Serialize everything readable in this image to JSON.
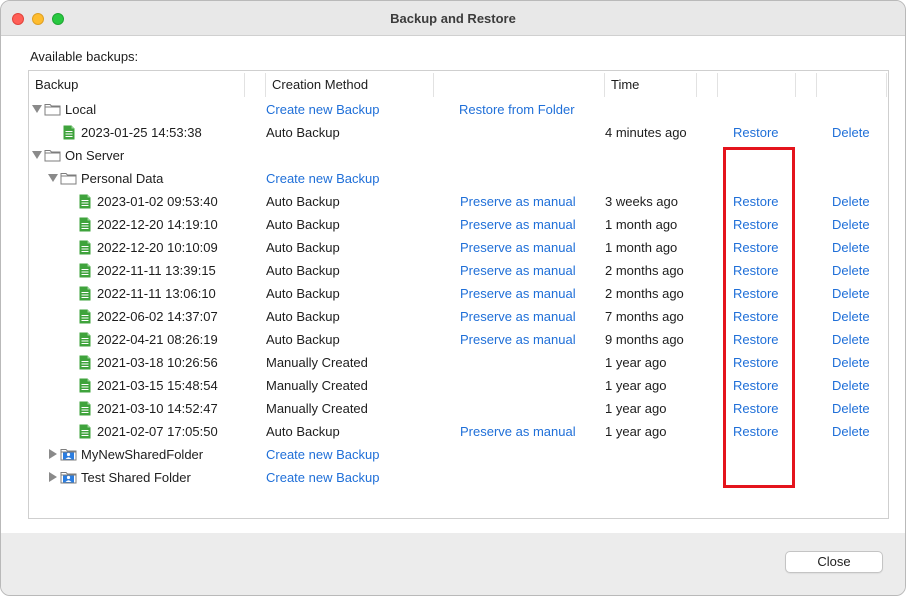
{
  "window": {
    "title": "Backup and Restore"
  },
  "label": "Available backups:",
  "columns": {
    "backup": "Backup",
    "creation_method": "Creation Method",
    "time": "Time"
  },
  "groups": {
    "local": {
      "name": "Local",
      "create": "Create new Backup",
      "restore_from_folder": "Restore from Folder",
      "items": [
        {
          "name": "2023-01-25 14:53:38",
          "method": "Auto Backup",
          "preserve": "",
          "time": "4 minutes ago",
          "restore": "Restore",
          "delete": "Delete"
        }
      ]
    },
    "server": {
      "name": "On Server",
      "personal": {
        "name": "Personal Data",
        "create": "Create new Backup",
        "items": [
          {
            "name": "2023-01-02 09:53:40",
            "method": "Auto Backup",
            "preserve": "Preserve as manual",
            "time": "3 weeks ago",
            "restore": "Restore",
            "delete": "Delete"
          },
          {
            "name": "2022-12-20 14:19:10",
            "method": "Auto Backup",
            "preserve": "Preserve as manual",
            "time": "1 month ago",
            "restore": "Restore",
            "delete": "Delete"
          },
          {
            "name": "2022-12-20 10:10:09",
            "method": "Auto Backup",
            "preserve": "Preserve as manual",
            "time": "1 month ago",
            "restore": "Restore",
            "delete": "Delete"
          },
          {
            "name": "2022-11-11 13:39:15",
            "method": "Auto Backup",
            "preserve": "Preserve as manual",
            "time": "2 months ago",
            "restore": "Restore",
            "delete": "Delete"
          },
          {
            "name": "2022-11-11 13:06:10",
            "method": "Auto Backup",
            "preserve": "Preserve as manual",
            "time": "2 months ago",
            "restore": "Restore",
            "delete": "Delete"
          },
          {
            "name": "2022-06-02 14:37:07",
            "method": "Auto Backup",
            "preserve": "Preserve as manual",
            "time": "7 months ago",
            "restore": "Restore",
            "delete": "Delete"
          },
          {
            "name": "2022-04-21 08:26:19",
            "method": "Auto Backup",
            "preserve": "Preserve as manual",
            "time": "9 months ago",
            "restore": "Restore",
            "delete": "Delete"
          },
          {
            "name": "2021-03-18 10:26:56",
            "method": "Manually Created",
            "preserve": "",
            "time": "1 year ago",
            "restore": "Restore",
            "delete": "Delete"
          },
          {
            "name": "2021-03-15 15:48:54",
            "method": "Manually Created",
            "preserve": "",
            "time": "1 year ago",
            "restore": "Restore",
            "delete": "Delete"
          },
          {
            "name": "2021-03-10 14:52:47",
            "method": "Manually Created",
            "preserve": "",
            "time": "1 year ago",
            "restore": "Restore",
            "delete": "Delete"
          },
          {
            "name": "2021-02-07 17:05:50",
            "method": "Auto Backup",
            "preserve": "Preserve as manual",
            "time": "1 year ago",
            "restore": "Restore",
            "delete": "Delete"
          }
        ]
      },
      "shared": [
        {
          "name": "MyNewSharedFolder",
          "create": "Create new Backup"
        },
        {
          "name": "Test Shared Folder",
          "create": "Create new Backup"
        }
      ]
    }
  },
  "footer": {
    "close_label": "Close"
  },
  "colors": {
    "link": "#1f6fd8",
    "highlight": "#e4141c",
    "doc_icon": "#3fa33c"
  },
  "icons": {
    "folder": "folder-icon",
    "shared_folder": "shared-folder-icon",
    "backup_file": "document-icon"
  }
}
